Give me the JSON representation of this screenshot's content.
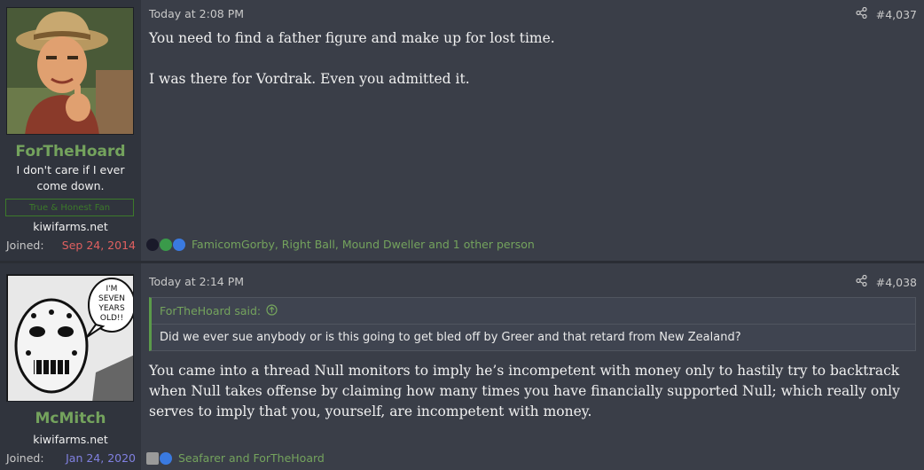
{
  "posts": [
    {
      "user": {
        "name": "ForTheHoard",
        "title": "I don't care if I ever come down.",
        "banner": "True & Honest Fan",
        "site": "kiwifarms.net",
        "joined_label": "Joined:",
        "joined_date": "Sep 24, 2014"
      },
      "date": "Today at 2:08 PM",
      "number": "#4,037",
      "body": [
        "You need to find a father figure and make up for lost time.",
        "I was there for Vordrak. Even you admitted it."
      ],
      "reactions_text": "FamicomGorby, Right Ball, Mound Dweller and 1 other person"
    },
    {
      "user": {
        "name": "McMitch",
        "site": "kiwifarms.net",
        "joined_label": "Joined:",
        "joined_date": "Jan 24, 2020",
        "avatar_caption": "I'M SEVEN YEARS OLD!!"
      },
      "date": "Today at 2:14 PM",
      "number": "#4,038",
      "quote": {
        "author": "ForTheHoard said:",
        "text": "Did we ever sue anybody or is this going to get bled off by Greer and that retard from New Zealand?"
      },
      "body": [
        "You came into a thread Null monitors to imply he’s incompetent with money only to hastily try to backtrack when Null takes offense by claiming how many times you have financially supported Null; which really only serves to imply that you, yourself, are incompetent with money."
      ],
      "reactions_text": "Seafarer and ForTheHoard"
    }
  ],
  "colors": {
    "username": "#74a35d",
    "joined_date_1": "#e06060",
    "joined_date_2": "#8080e0"
  }
}
